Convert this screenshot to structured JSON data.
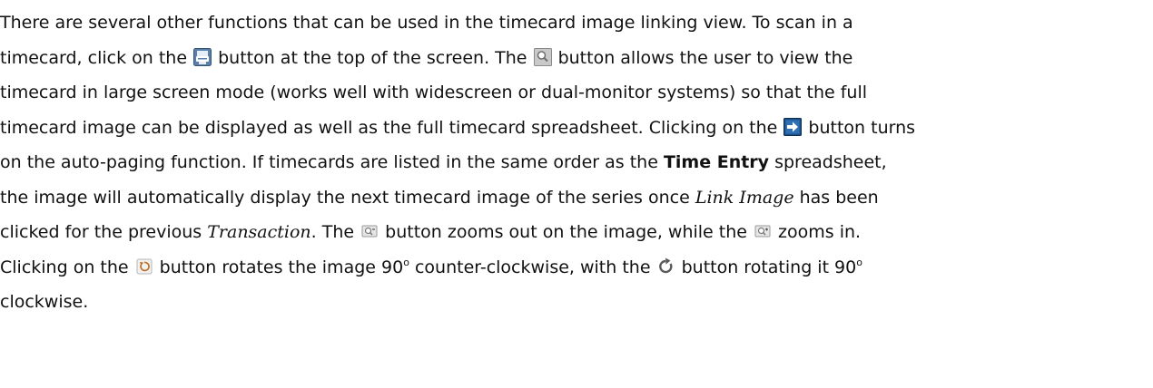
{
  "paragraph": {
    "l1": "There are several other functions that can be used in the timecard image linking view.  To scan in a",
    "l2a": "timecard, click on the ",
    "l2b": " button at the top of the screen.  The ",
    "l2c": " button allows the user to view the",
    "l3": "timecard in large screen mode (works well with widescreen or dual-monitor systems) so that the full",
    "l4": "timecard image can be displayed as well as the full timecard spreadsheet.  Clicking on the ",
    "l4b": " button turns",
    "l5a": "on the auto-paging function.  If timecards are listed in the same order as the ",
    "l5bold": "Time Entry",
    "l5b": " spreadsheet,",
    "l6a": "the image will automatically display the next timecard image of the series once ",
    "l6ital": "Link Image",
    "l6b": " has been",
    "l7a": "clicked for the previous ",
    "l7ital": "Transaction",
    "l7b": ".  The ",
    "l7c": " button zooms out on the image, while the ",
    "l7d": " zooms in.",
    "l8a": "Clicking on the ",
    "l8b": " button rotates the image 90",
    "l8sup1": "o",
    "l8c": " counter-clockwise, with the ",
    "l8d": " button rotating it 90",
    "l8sup2": "o",
    "l9": "clockwise."
  },
  "icons": {
    "scan": "scanner-icon",
    "large_view": "magnifier-icon",
    "auto_page": "arrow-right-icon",
    "zoom_out": "zoom-out-icon",
    "zoom_in": "zoom-in-icon",
    "rotate_ccw": "rotate-ccw-icon",
    "rotate_cw": "rotate-cw-icon"
  }
}
